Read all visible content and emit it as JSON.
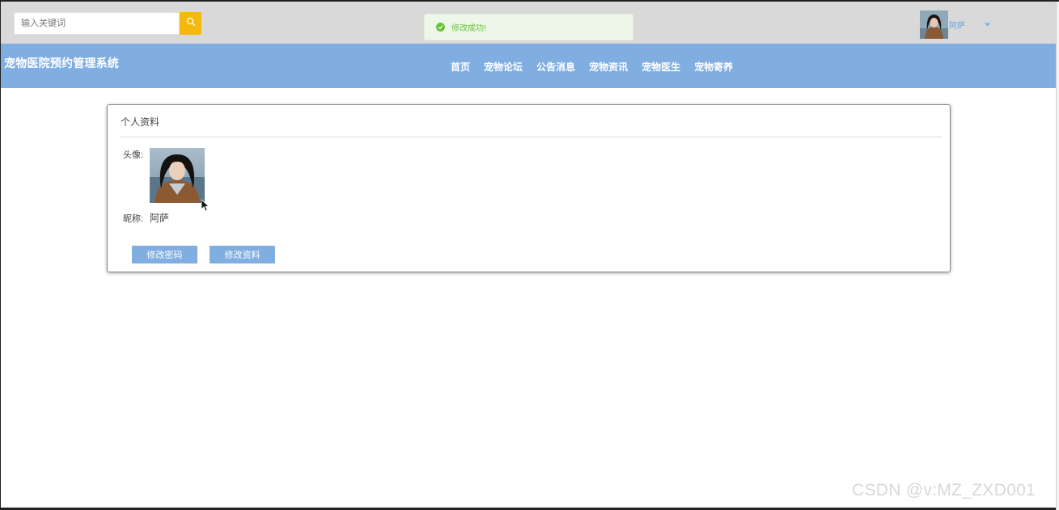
{
  "search": {
    "placeholder": "输入关键词",
    "value": ""
  },
  "toast": {
    "message": "修改成功!",
    "status_color": "#67c23a"
  },
  "user": {
    "name": "阿萨"
  },
  "header": {
    "site_title": "宠物医院预约管理系统",
    "nav": [
      {
        "label": "首页"
      },
      {
        "label": "宠物论坛"
      },
      {
        "label": "公告消息"
      },
      {
        "label": "宠物资讯"
      },
      {
        "label": "宠物医生"
      },
      {
        "label": "宠物寄养"
      }
    ]
  },
  "profile": {
    "title": "个人资料",
    "avatar_label": "头像:",
    "nickname_label": "昵称:",
    "nickname": "阿萨",
    "buttons": {
      "change_password": "修改密码",
      "edit_profile": "修改资料"
    }
  },
  "colors": {
    "nav_bg": "#80aee0",
    "topbar_bg": "#d9d9d9",
    "search_button": "#f5b90e",
    "button_bg": "#80aee0"
  },
  "watermark": "CSDN @v:MZ_ZXD001"
}
